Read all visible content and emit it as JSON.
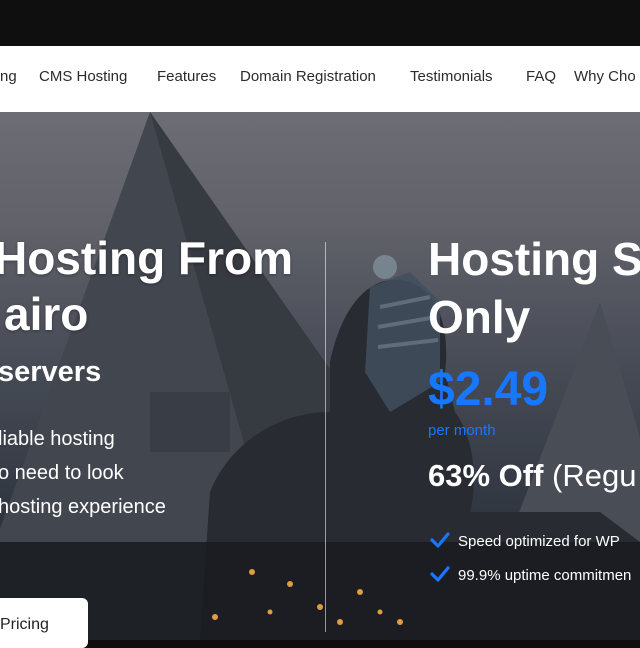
{
  "nav": {
    "items": [
      {
        "label": "ng"
      },
      {
        "label": "CMS Hosting"
      },
      {
        "label": "Features"
      },
      {
        "label": "Domain Registration"
      },
      {
        "label": "Testimonials"
      },
      {
        "label": "FAQ"
      },
      {
        "label": "Why Cho"
      }
    ]
  },
  "hero": {
    "left": {
      "title_line1": "Hosting From",
      "title_line2": "airo",
      "subtitle": "servers",
      "lines": [
        "liable hosting",
        "o need to look",
        "hosting experience"
      ],
      "button_label": "Pricing"
    },
    "right": {
      "title_line1": "Hosting S",
      "title_line2": "Only",
      "price": "$2.49",
      "per_month": "per month",
      "discount_bold": "63% Off",
      "discount_rest": " (Regu",
      "features": [
        "Speed optimized for WP",
        "99.9% uptime commitmen"
      ]
    }
  },
  "colors": {
    "accent_blue": "#1877ff",
    "nav_background": "#ffffff",
    "top_bar": "#0f0f10"
  }
}
